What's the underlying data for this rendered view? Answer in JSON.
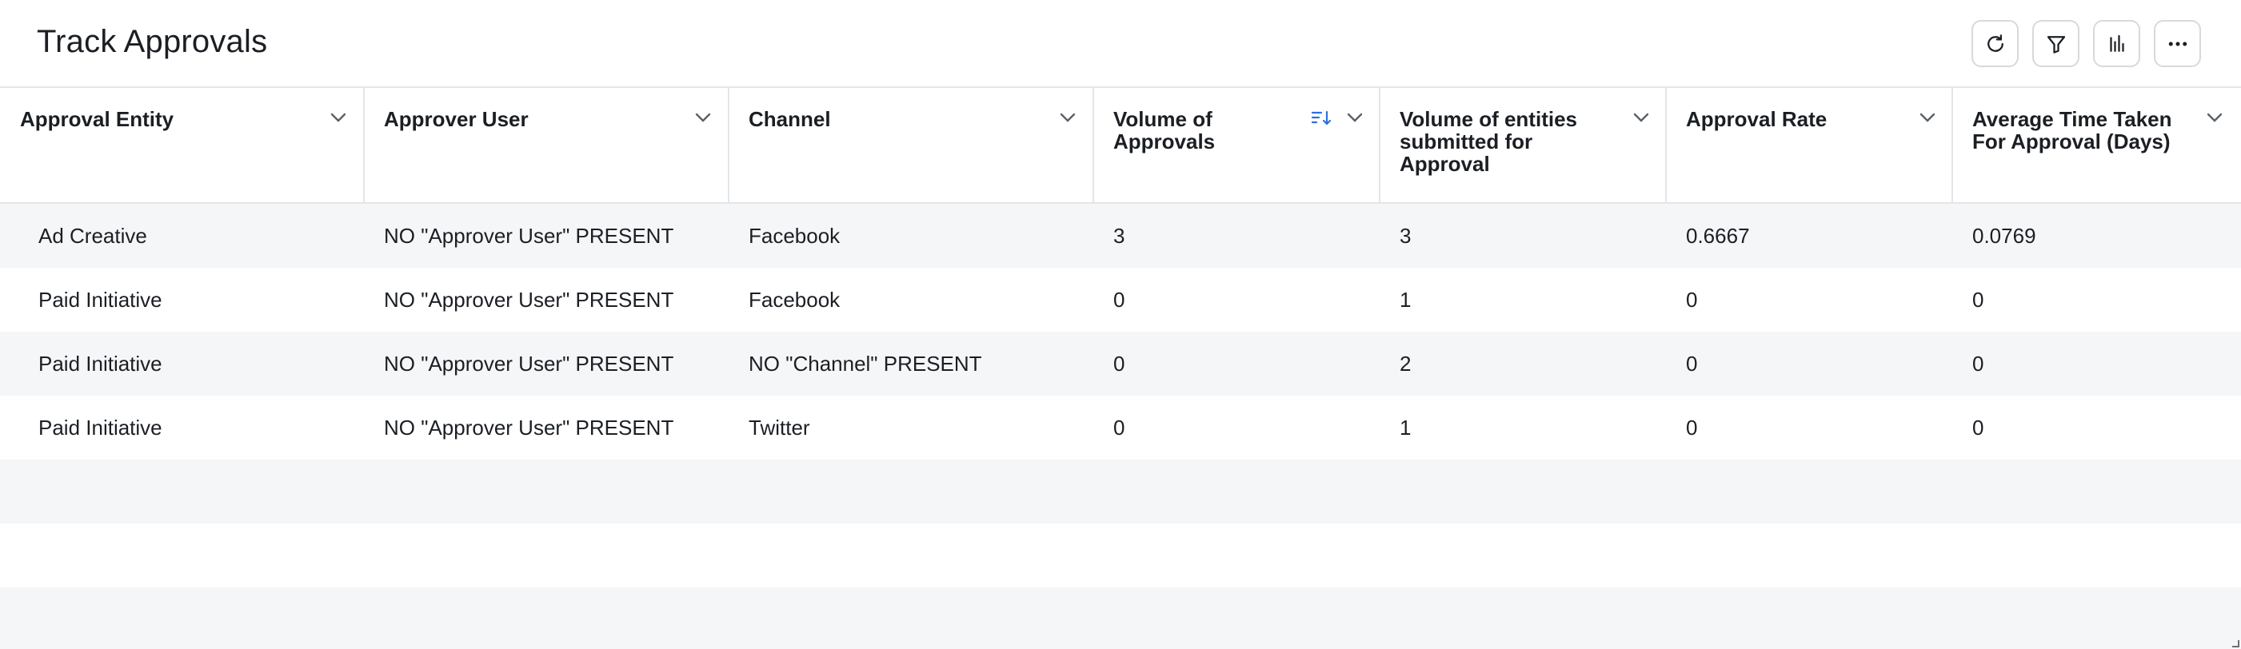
{
  "header": {
    "title": "Track Approvals",
    "actions": [
      {
        "name": "refresh-button",
        "icon": "refresh-icon"
      },
      {
        "name": "filter-button",
        "icon": "filter-icon"
      },
      {
        "name": "chart-button",
        "icon": "bar-chart-icon"
      },
      {
        "name": "more-button",
        "icon": "more-icon"
      }
    ]
  },
  "table": {
    "columns": [
      {
        "label": "Approval Entity"
      },
      {
        "label": "Approver User"
      },
      {
        "label": "Channel"
      },
      {
        "label": "Volume of Approvals",
        "sorted": "desc"
      },
      {
        "label": "Volume of entities submitted for Approval"
      },
      {
        "label": "Approval Rate"
      },
      {
        "label": "Average Time Taken For Approval (Days)"
      }
    ],
    "rows": [
      [
        "Ad Creative",
        "NO \"Approver User\" PRESENT",
        "Facebook",
        "3",
        "3",
        "0.6667",
        "0.0769"
      ],
      [
        "Paid Initiative",
        "NO \"Approver User\" PRESENT",
        "Facebook",
        "0",
        "1",
        "0",
        "0"
      ],
      [
        "Paid Initiative",
        "NO \"Approver User\" PRESENT",
        "NO \"Channel\" PRESENT",
        "0",
        "2",
        "0",
        "0"
      ],
      [
        "Paid Initiative",
        "NO \"Approver User\" PRESENT",
        "Twitter",
        "0",
        "1",
        "0",
        "0"
      ]
    ]
  },
  "colors": {
    "border": "#e3e5e8",
    "stripe": "#f5f6f8",
    "sort_accent": "#2f6fde"
  }
}
